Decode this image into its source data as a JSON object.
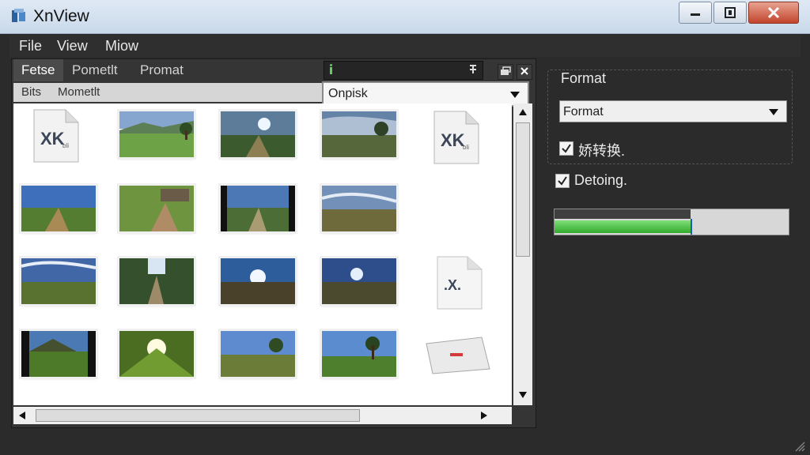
{
  "window": {
    "title": "XnView"
  },
  "menu": {
    "items": [
      "File",
      "View",
      "Miow"
    ]
  },
  "tabs": [
    "Fetse",
    "Pometlt",
    "Promat"
  ],
  "subheader": {
    "items": [
      "Bits",
      "Mometlt"
    ]
  },
  "dropdown": {
    "selected": "Onpisk"
  },
  "right_panel": {
    "format_label": "Format",
    "format_select": "Format",
    "options": [
      {
        "label": "娇转换.",
        "checked": true
      },
      {
        "label": "Detoing.",
        "checked": true
      }
    ],
    "progress_fraction": 0.58
  },
  "thumbnail_labels": {
    "doc_xk": "XK",
    "doc_x": ".X.",
    "doc_xk_sub": "bli"
  },
  "colors": {
    "accent_green": "#31a92d",
    "dark_background": "#2b2b2b",
    "window_chrome": "#c9d9ea"
  }
}
